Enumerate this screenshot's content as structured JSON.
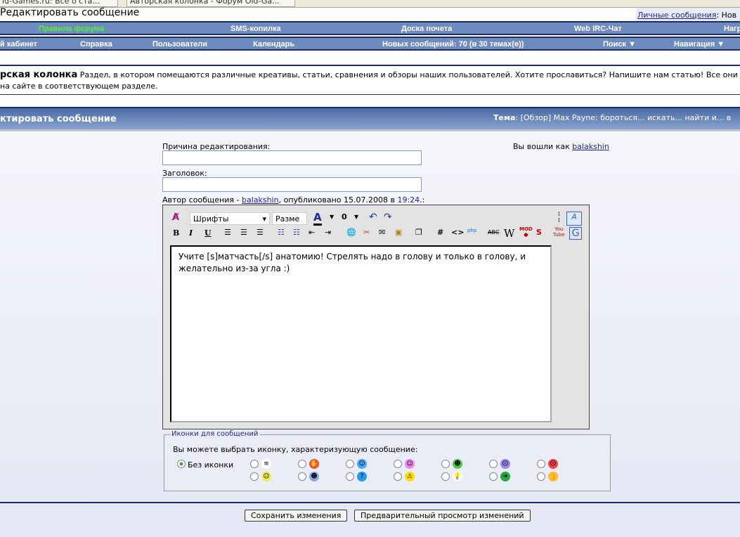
{
  "browser_tabs": [
    {
      "label": "ld-Games.ru: Все о ста..."
    },
    {
      "label": "Авторская колонка - Форум Old-Ga..."
    }
  ],
  "page_title": "Редактировать сообщение",
  "pm_link": "Личные сообщения",
  "pm_suffix": ": Нов",
  "nav1": [
    "Правила форума",
    "SMS-копилка",
    "Доска почета",
    "Web IRC-Чат",
    "Нагр"
  ],
  "nav2": [
    "й кабинет",
    "Справка",
    "Пользователи",
    "Календарь",
    "Новых сообщений: 70 (в 30 темах(е))",
    "Поиск ▼",
    "Навигация ▼"
  ],
  "forum": {
    "name": "рская колонка",
    "description": "Раздел, в котором помещаются различные креативы, статьи, сравнения и обзоры наших пользователей. Хотите прославиться? Напишите нам статью! Все они",
    "description2": "на сайте в соответствующем разделе."
  },
  "header": {
    "title": "ктировать сообщение",
    "topic_label": "Тема",
    "topic": ": [Обзор] Max Payne: бороться... искать... найти и... в"
  },
  "form": {
    "reason_label": "Причина редактирования:",
    "reason_value": "",
    "title_label": "Заголовок:",
    "title_value": "",
    "author_prefix": "Автор сообщения - ",
    "author": "balakshin",
    "published": ", опубликовано 15.07.2008 в ",
    "time": "19:24",
    "time_suffix": ".:",
    "logged_in_prefix": "Вы вошли как ",
    "logged_in_user": "balakshin"
  },
  "editor": {
    "font_select": "Шрифты",
    "size_select": "Разме",
    "content": "Учите [s]матчасть[/s] анатомию! Стрелять надо в голову и только в голову, и желательно из-за угла :)"
  },
  "icons": {
    "legend": "Иконки для сообщений",
    "prompt": "Вы можете выбрать иконку, характеризующую сообщение:",
    "no_icon": "Без иконки",
    "selected": "no_icon"
  },
  "buttons": {
    "save": "Сохранить изменения",
    "preview": "Предварительный просмотр изменений"
  },
  "colors": {
    "nav_bg": "#6e8bbf",
    "accent_green": "#55ee33",
    "link": "#22229c"
  }
}
